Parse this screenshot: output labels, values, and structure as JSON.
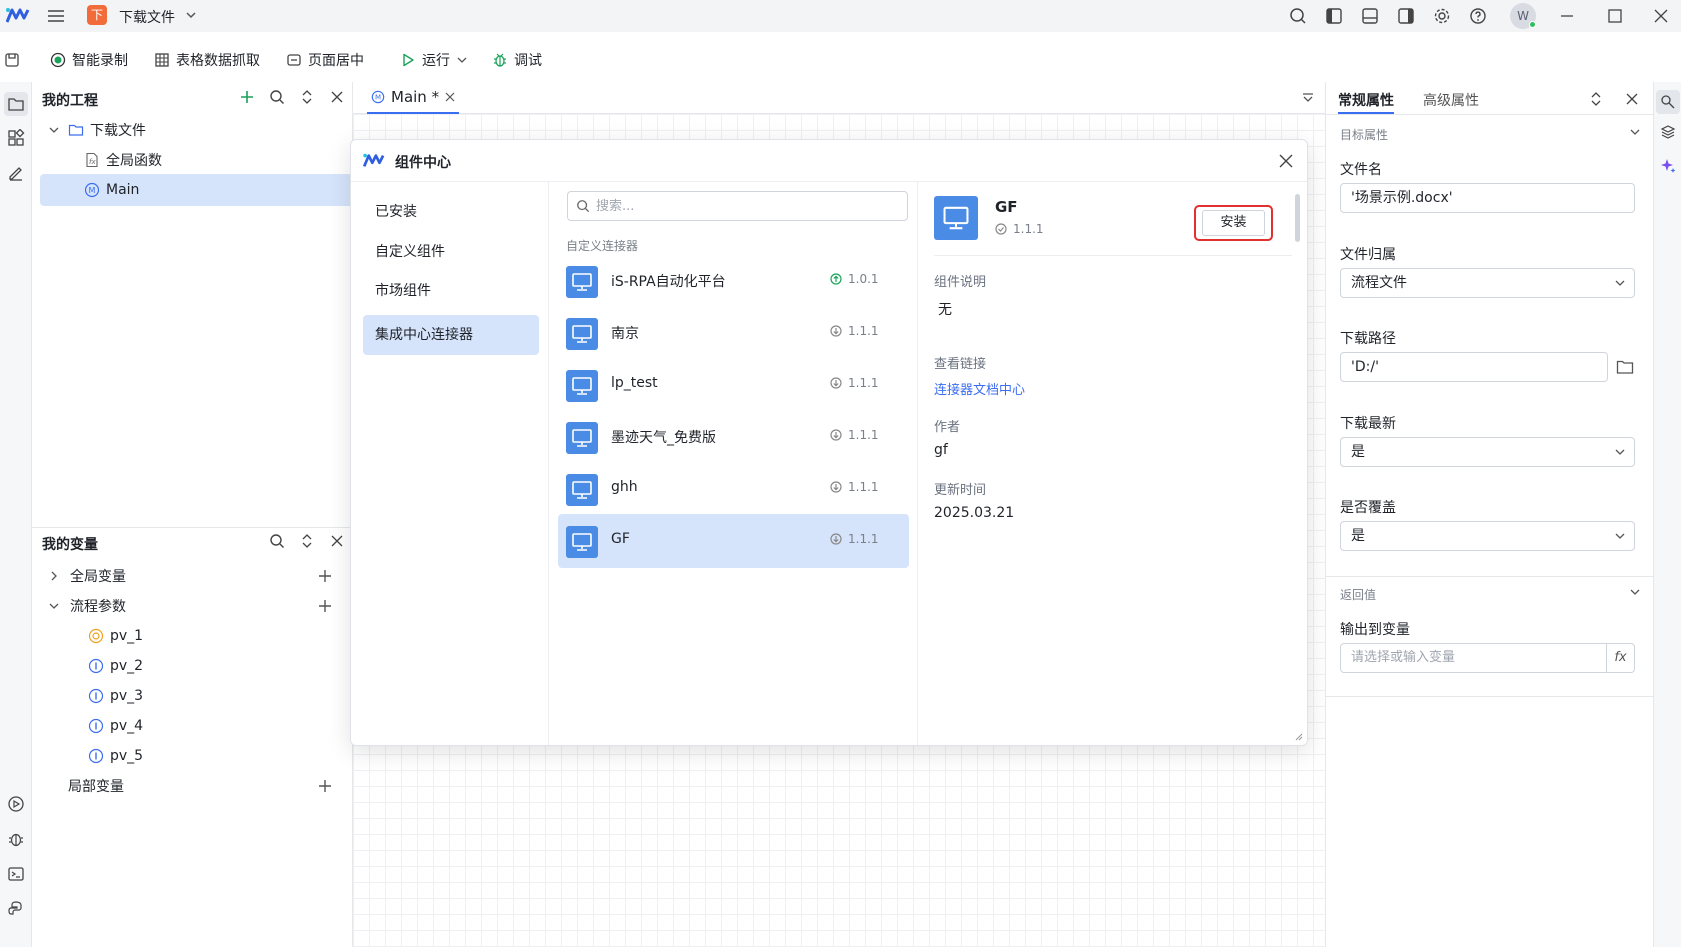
{
  "titlebar": {
    "project_badge": "下",
    "project_name": "下载文件",
    "avatar_initial": "W"
  },
  "toolbar": {
    "smart_record": "智能录制",
    "table_capture": "表格数据抓取",
    "page_center": "页面居中",
    "run": "运行",
    "debug": "调试"
  },
  "project_panel": {
    "title": "我的工程",
    "tree": {
      "root": "下载文件",
      "global_funcs": "全局函数",
      "main": "Main"
    }
  },
  "variables_panel": {
    "title": "我的变量",
    "global_vars": "全局变量",
    "flow_params": "流程参数",
    "params": [
      "pv_1",
      "pv_2",
      "pv_3",
      "pv_4",
      "pv_5"
    ],
    "local_vars": "局部变量"
  },
  "editor": {
    "tab_label": "Main *"
  },
  "modal": {
    "title": "组件中心",
    "nav": [
      "已安装",
      "自定义组件",
      "市场组件",
      "集成中心连接器"
    ],
    "active_nav": 3,
    "search_placeholder": "搜索...",
    "list_header": "自定义连接器",
    "components": [
      {
        "name": "iS-RPA自动化平台",
        "version": "1.0.1",
        "status": "update"
      },
      {
        "name": "南京",
        "version": "1.1.1",
        "status": "download"
      },
      {
        "name": "lp_test",
        "version": "1.1.1",
        "status": "download"
      },
      {
        "name": "墨迹天气_免费版",
        "version": "1.1.1",
        "status": "download"
      },
      {
        "name": "ghh",
        "version": "1.1.1",
        "status": "download"
      },
      {
        "name": "GF",
        "version": "1.1.1",
        "status": "download"
      }
    ],
    "selected_index": 5,
    "detail": {
      "name": "GF",
      "version": "1.1.1",
      "install_label": "安装",
      "desc_label": "组件说明",
      "desc_value": "无",
      "link_label": "查看链接",
      "link_value": "连接器文档中心",
      "author_label": "作者",
      "author_value": "gf",
      "updated_label": "更新时间",
      "updated_value": "2025.03.21"
    }
  },
  "props_panel": {
    "tab_general": "常规属性",
    "tab_advanced": "高级属性",
    "section_target": "目标属性",
    "file_name_label": "文件名",
    "file_name_value": "'场景示例.docx'",
    "file_owner_label": "文件归属",
    "file_owner_value": "流程文件",
    "download_path_label": "下载路径",
    "download_path_value": "'D:/'",
    "download_latest_label": "下载最新",
    "download_latest_value": "是",
    "overwrite_label": "是否覆盖",
    "overwrite_value": "是",
    "section_return": "返回值",
    "output_var_label": "输出到变量",
    "output_var_placeholder": "请选择或输入变量",
    "fx_label": "fx"
  },
  "colors": {
    "accent": "#3b6df0",
    "selection": "#d6e4fb",
    "component_icon": "#4a8be6",
    "highlight_border": "#e0312f",
    "project_badge": "#f26b3a"
  }
}
